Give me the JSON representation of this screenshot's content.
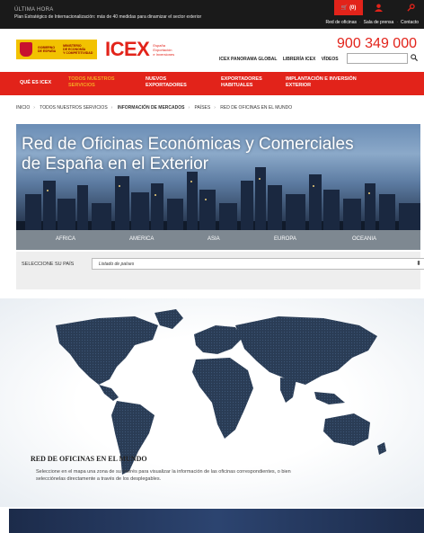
{
  "topbar": {
    "kicker": "ÚLTIMA HORA",
    "headline": "Plan Estratégico de Internacionalización: más de 40 medidas para dinamizar el sector exterior",
    "cart_count": "(0)",
    "links": [
      "Red de oficinas",
      "Sala de prensa",
      "Contacto"
    ]
  },
  "header": {
    "icex_word": "ICEX",
    "icex_sub": [
      "España",
      "Exportación",
      "e Inversiones"
    ],
    "phone": "900 349 000",
    "links": [
      "ICEX PANORAMA GLOBAL",
      "LIBRERÍA ICEX",
      "VÍDEOS"
    ]
  },
  "nav": {
    "items": [
      {
        "label": "QUÉ ES ICEX"
      },
      {
        "label": "TODOS NUESTROS SERVICIOS"
      },
      {
        "label": "NUEVOS EXPORTADORES"
      },
      {
        "label": "EXPORTADORES HABITUALES"
      },
      {
        "label": "IMPLANTACIÓN E INVERSIÓN EXTERIOR"
      }
    ]
  },
  "breadcrumb": [
    "INICIO",
    "TODOS NUESTROS SERVICIOS",
    "INFORMACIÓN DE MERCADOS",
    "PAÍSES",
    "RED DE OFICINAS EN EL MUNDO"
  ],
  "hero": {
    "title_line1": "Red de Oficinas Económicas y Comerciales",
    "title_line2": "de España en el Exterior"
  },
  "continents": [
    "AFRICA",
    "AMERICA",
    "ASIA",
    "EUROPA",
    "OCEANIA"
  ],
  "selector": {
    "label": "SELECCIONE SU PAÍS",
    "value": "Listado de países"
  },
  "map_section": {
    "title": "RED DE OFICINAS EN EL MUNDO",
    "description": "Seleccione en el mapa una zona de su interés para visualizar la información de las oficinas correspondientes, o bien selecciónelas directamente a través de los desplegables."
  },
  "colors": {
    "brand_red": "#e2231a",
    "active_nav": "#f5a623",
    "map_fill": "#2a3c55"
  }
}
